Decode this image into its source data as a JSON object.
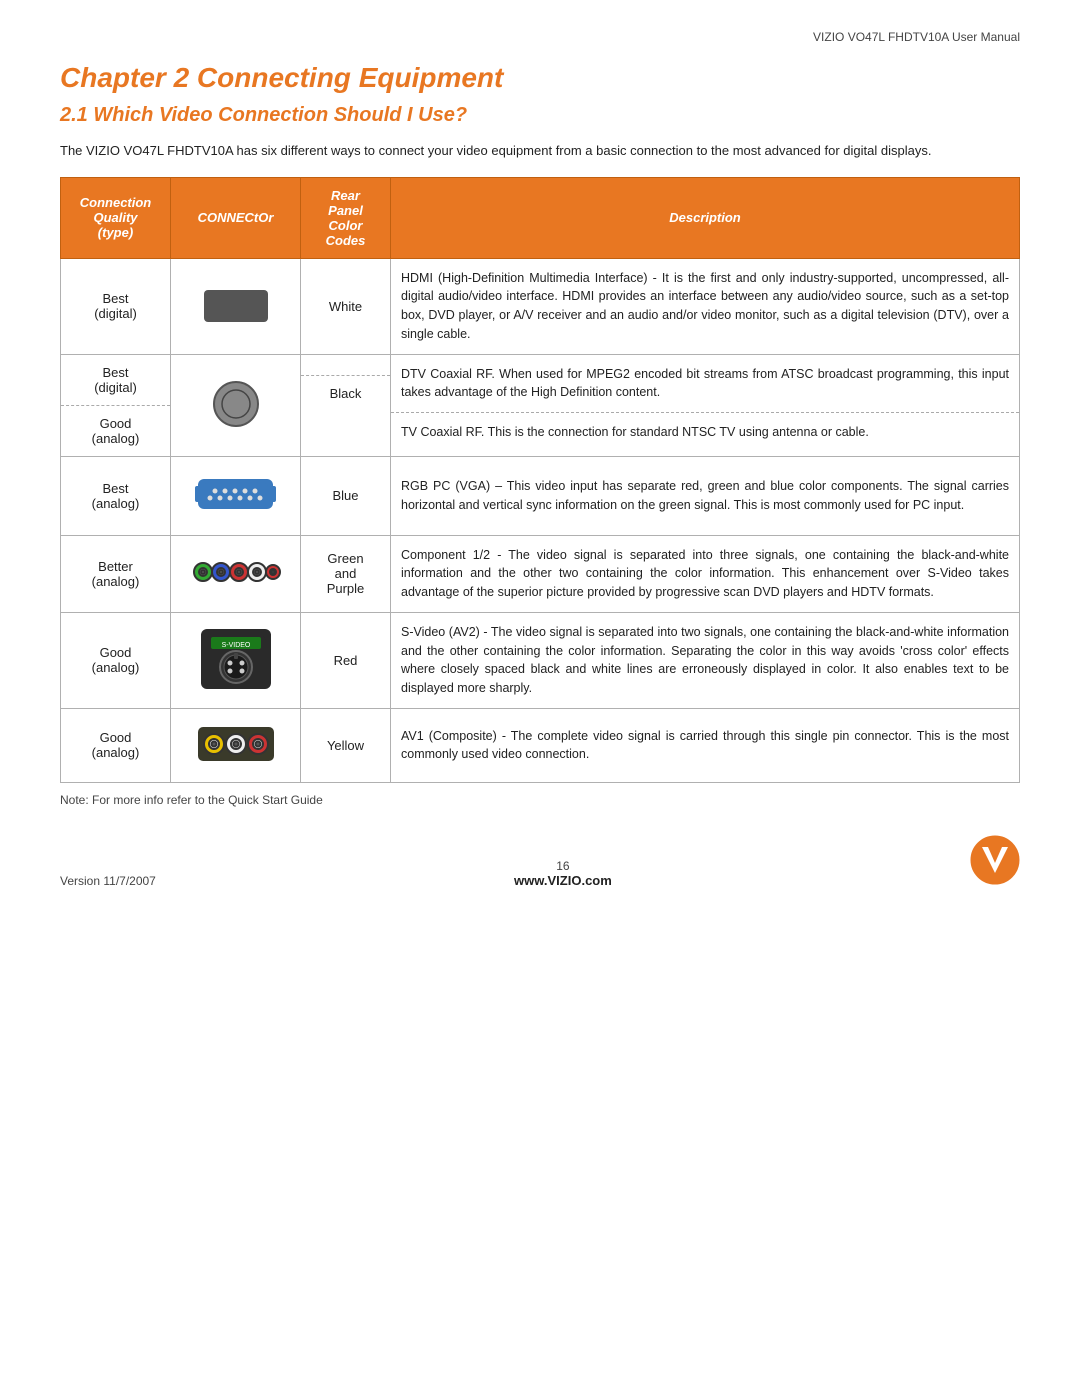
{
  "page": {
    "header": "VIZIO VO47L FHDTV10A User Manual",
    "chapter_title": "Chapter 2  Connecting Equipment",
    "section_title": "2.1 Which Video Connection Should I Use?",
    "intro": "The VIZIO VO47L FHDTV10A has six different ways to connect your video equipment from a basic connection to the most advanced for digital displays.",
    "note": "Note:  For more info refer to the Quick Start Guide",
    "footer_version": "Version 11/7/2007",
    "footer_page": "16",
    "footer_website": "www.VIZIO.com"
  },
  "table": {
    "headers": [
      "Connection Quality (type)",
      "CONNECtOr",
      "Rear Panel Color Codes",
      "Description"
    ],
    "rows": [
      {
        "quality": "Best\n(digital)",
        "connector_type": "hdmi",
        "color_label": "White",
        "description": "HDMI (High-Definition Multimedia Interface) - It is the first and only industry-supported, uncompressed, all-digital audio/video interface.  HDMI provides an interface between any audio/video source, such as a set-top box, DVD player, or A/V receiver and an audio and/or video monitor, such as a digital television (DTV), over a single cable."
      },
      {
        "quality": "Best\n(digital)\n\nGood\n(analog)",
        "connector_type": "coax",
        "color_label": "Black",
        "description_top": "DTV Coaxial RF.  When used for MPEG2 encoded bit streams from ATSC broadcast programming, this input takes advantage of the High Definition content.",
        "description_bottom": "TV Coaxial RF.  This is the connection for standard NTSC TV using antenna or cable.",
        "split": true
      },
      {
        "quality": "Best\n(analog)",
        "connector_type": "vga",
        "color_label": "Blue",
        "description": "RGB PC (VGA) – This video input has separate red, green and blue color components.   The signal carries horizontal and vertical sync information on the green signal.  This is most commonly used for PC input."
      },
      {
        "quality": "Better\n(analog)",
        "connector_type": "component",
        "color_label": "Green\nand\nPurple",
        "description": "Component 1/2 - The video signal is separated into three signals, one containing the black-and-white information and the other two containing the color information. This enhancement over S-Video takes advantage of the superior picture provided by progressive scan DVD players and HDTV formats."
      },
      {
        "quality": "Good\n(analog)",
        "connector_type": "svideo",
        "color_label": "Red",
        "description": "S-Video (AV2) - The video signal is separated into two signals, one containing the black-and-white information and the other containing the color information. Separating the color in this way avoids 'cross color' effects where closely spaced black and white lines are erroneously displayed in color.  It also enables text to be displayed more sharply."
      },
      {
        "quality": "Good\n(analog)",
        "connector_type": "composite",
        "color_label": "Yellow",
        "description": "AV1 (Composite) - The complete video signal is carried through this single pin connector. This is the most commonly used video connection."
      }
    ]
  }
}
